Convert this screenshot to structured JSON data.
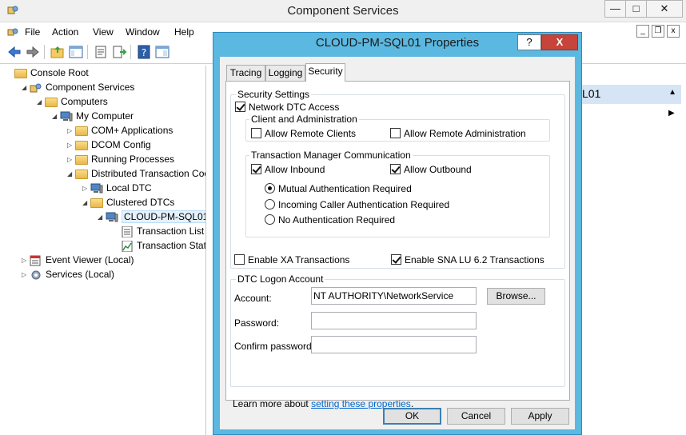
{
  "window": {
    "title": "Component Services",
    "minimize": "—",
    "maximize": "□",
    "close": "✕"
  },
  "menu": [
    "File",
    "Action",
    "View",
    "Window",
    "Help"
  ],
  "mdi": {
    "minimize": "_",
    "restore": "❐",
    "close": "x"
  },
  "tree": [
    {
      "label": "Console Root",
      "level": 0,
      "arrow": "",
      "icon": "folder-icon"
    },
    {
      "label": "Component Services",
      "level": 1,
      "arrow": "◢",
      "icon": "component-services-icon"
    },
    {
      "label": "Computers",
      "level": 2,
      "arrow": "◢",
      "icon": "folder-icon"
    },
    {
      "label": "My Computer",
      "level": 3,
      "arrow": "◢",
      "icon": "computer-icon"
    },
    {
      "label": "COM+ Applications",
      "level": 4,
      "arrow": "▷",
      "icon": "folder-icon"
    },
    {
      "label": "DCOM Config",
      "level": 4,
      "arrow": "▷",
      "icon": "folder-icon"
    },
    {
      "label": "Running Processes",
      "level": 4,
      "arrow": "▷",
      "icon": "folder-icon"
    },
    {
      "label": "Distributed Transaction Coo",
      "level": 4,
      "arrow": "◢",
      "icon": "folder-icon"
    },
    {
      "label": "Local DTC",
      "level": 5,
      "arrow": "▷",
      "icon": "computer-icon"
    },
    {
      "label": "Clustered DTCs",
      "level": 5,
      "arrow": "◢",
      "icon": "folder-icon"
    },
    {
      "label": "CLOUD-PM-SQL01",
      "level": 6,
      "arrow": "◢",
      "icon": "computer-icon",
      "selected": true
    },
    {
      "label": "Transaction List",
      "level": 7,
      "arrow": "",
      "icon": "list-icon"
    },
    {
      "label": "Transaction Statis",
      "level": 7,
      "arrow": "",
      "icon": "chart-icon"
    },
    {
      "label": "Event Viewer (Local)",
      "level": 1,
      "arrow": "▷",
      "icon": "event-viewer-icon"
    },
    {
      "label": "Services (Local)",
      "level": 1,
      "arrow": "▷",
      "icon": "gear-icon"
    }
  ],
  "right_pane": {
    "actions_header_fragment": "L01"
  },
  "dialog": {
    "title": "CLOUD-PM-SQL01 Properties",
    "help": "?",
    "close": "X",
    "tabs": [
      "Tracing",
      "Logging",
      "Security"
    ],
    "active_tab": "Security",
    "security_settings": {
      "label": "Security Settings",
      "network_dtc_access": {
        "label": "Network DTC Access",
        "checked": true
      },
      "client_admin": {
        "label": "Client and Administration",
        "allow_remote_clients": {
          "label": "Allow Remote Clients",
          "checked": false
        },
        "allow_remote_admin": {
          "label": "Allow Remote Administration",
          "checked": false
        }
      },
      "tm_comm": {
        "label": "Transaction Manager Communication",
        "allow_inbound": {
          "label": "Allow Inbound",
          "checked": true
        },
        "allow_outbound": {
          "label": "Allow Outbound",
          "checked": true
        },
        "mutual_auth": {
          "label": "Mutual Authentication Required",
          "selected": true
        },
        "incoming_auth": {
          "label": "Incoming Caller Authentication Required",
          "selected": false
        },
        "no_auth": {
          "label": "No Authentication Required",
          "selected": false
        }
      },
      "enable_xa": {
        "label": "Enable XA Transactions",
        "checked": false
      },
      "enable_sna": {
        "label": "Enable SNA LU 6.2 Transactions",
        "checked": true
      }
    },
    "logon": {
      "label": "DTC Logon Account",
      "account_label": "Account:",
      "account_value": "NT AUTHORITY\\NetworkService",
      "browse": "Browse...",
      "password_label": "Password:",
      "password_value": "",
      "confirm_label": "Confirm password:",
      "confirm_value": ""
    },
    "learn_more_prefix": "Learn more about ",
    "learn_more_link": "setting these properties",
    "learn_more_suffix": ".",
    "buttons": {
      "ok": "OK",
      "cancel": "Cancel",
      "apply": "Apply"
    }
  }
}
